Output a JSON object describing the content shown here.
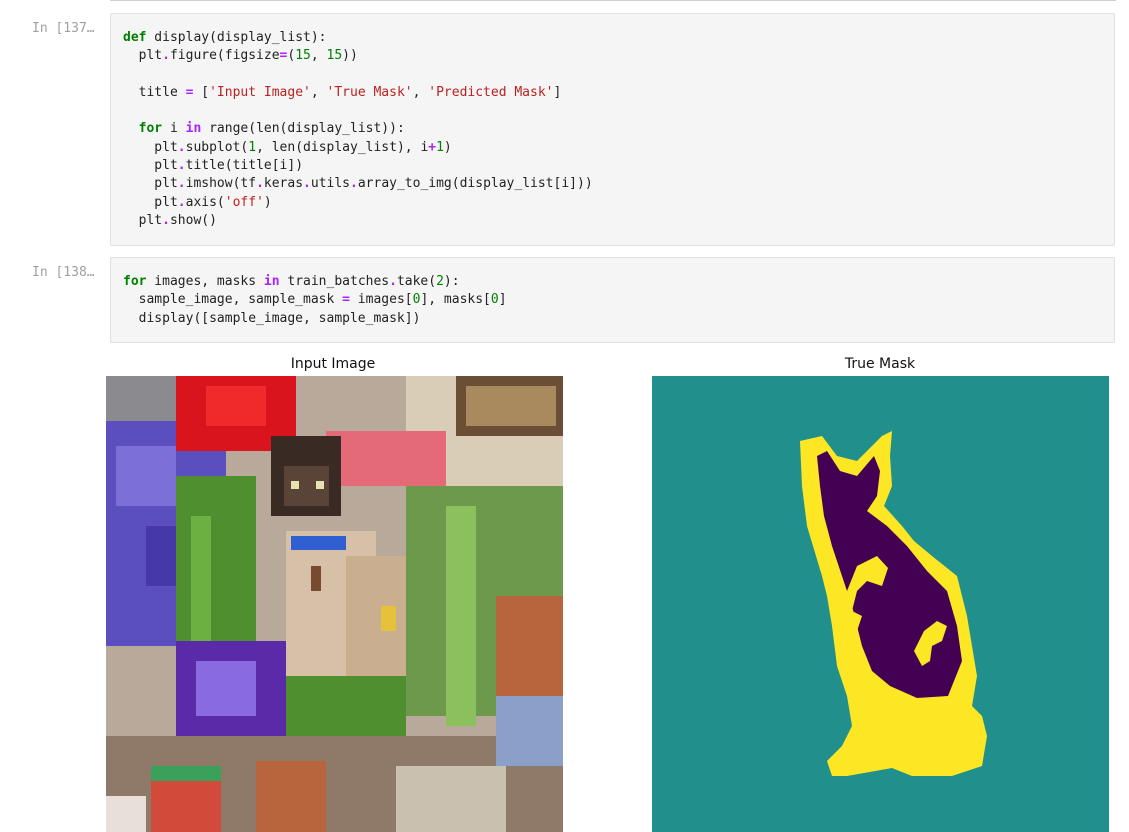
{
  "cells": [
    {
      "prompt": "In [137…",
      "code": [
        [
          [
            "kw",
            "def"
          ],
          [
            "fn",
            " display(display_list):"
          ]
        ],
        [
          [
            "fn",
            "  plt"
          ],
          [
            "op",
            "."
          ],
          [
            "fn",
            "figure(figsize"
          ],
          [
            "op",
            "="
          ],
          [
            "fn",
            "("
          ],
          [
            "num",
            "15"
          ],
          [
            "fn",
            ", "
          ],
          [
            "num",
            "15"
          ],
          [
            "fn",
            "))"
          ]
        ],
        [
          [
            "fn",
            ""
          ]
        ],
        [
          [
            "fn",
            "  title "
          ],
          [
            "op",
            "="
          ],
          [
            "fn",
            " ["
          ],
          [
            "str",
            "'Input Image'"
          ],
          [
            "fn",
            ", "
          ],
          [
            "str",
            "'True Mask'"
          ],
          [
            "fn",
            ", "
          ],
          [
            "str",
            "'Predicted Mask'"
          ],
          [
            "fn",
            "]"
          ]
        ],
        [
          [
            "fn",
            ""
          ]
        ],
        [
          [
            "fn",
            "  "
          ],
          [
            "kw",
            "for"
          ],
          [
            "fn",
            " i "
          ],
          [
            "op",
            "in"
          ],
          [
            "fn",
            " range(len(display_list)):"
          ]
        ],
        [
          [
            "fn",
            "    plt"
          ],
          [
            "op",
            "."
          ],
          [
            "fn",
            "subplot("
          ],
          [
            "num",
            "1"
          ],
          [
            "fn",
            ", len(display_list), i"
          ],
          [
            "op",
            "+"
          ],
          [
            "num",
            "1"
          ],
          [
            "fn",
            ")"
          ]
        ],
        [
          [
            "fn",
            "    plt"
          ],
          [
            "op",
            "."
          ],
          [
            "fn",
            "title(title[i])"
          ]
        ],
        [
          [
            "fn",
            "    plt"
          ],
          [
            "op",
            "."
          ],
          [
            "fn",
            "imshow(tf"
          ],
          [
            "op",
            "."
          ],
          [
            "fn",
            "keras"
          ],
          [
            "op",
            "."
          ],
          [
            "fn",
            "utils"
          ],
          [
            "op",
            "."
          ],
          [
            "fn",
            "array_to_img(display_list[i]))"
          ]
        ],
        [
          [
            "fn",
            "    plt"
          ],
          [
            "op",
            "."
          ],
          [
            "fn",
            "axis("
          ],
          [
            "str",
            "'off'"
          ],
          [
            "fn",
            ")"
          ]
        ],
        [
          [
            "fn",
            "  plt"
          ],
          [
            "op",
            "."
          ],
          [
            "fn",
            "show()"
          ]
        ]
      ]
    },
    {
      "prompt": "In [138…",
      "code": [
        [
          [
            "kw",
            "for"
          ],
          [
            "fn",
            " images, masks "
          ],
          [
            "op",
            "in"
          ],
          [
            "fn",
            " train_batches"
          ],
          [
            "op",
            "."
          ],
          [
            "fn",
            "take("
          ],
          [
            "num",
            "2"
          ],
          [
            "fn",
            "):"
          ]
        ],
        [
          [
            "fn",
            "  sample_image, sample_mask "
          ],
          [
            "op",
            "="
          ],
          [
            "fn",
            " images["
          ],
          [
            "num",
            "0"
          ],
          [
            "fn",
            "], masks["
          ],
          [
            "num",
            "0"
          ],
          [
            "fn",
            "]"
          ]
        ],
        [
          [
            "fn",
            "  display([sample_image, sample_mask])"
          ]
        ]
      ]
    }
  ],
  "output": {
    "titles": [
      "Input Image",
      "True Mask"
    ],
    "mask_colors": {
      "background": "#21908d",
      "border": "#fde725",
      "object": "#440154"
    },
    "photo_description_colors": {
      "red_flower": "#d9141c",
      "purple_flowers": "#5b4fc0",
      "cat_fur": "#d7c0a8",
      "cat_dark": "#3a2a24",
      "collar": "#2f5fd0",
      "pot": "#b8643c",
      "plant_green": "#4f8f2f"
    }
  }
}
